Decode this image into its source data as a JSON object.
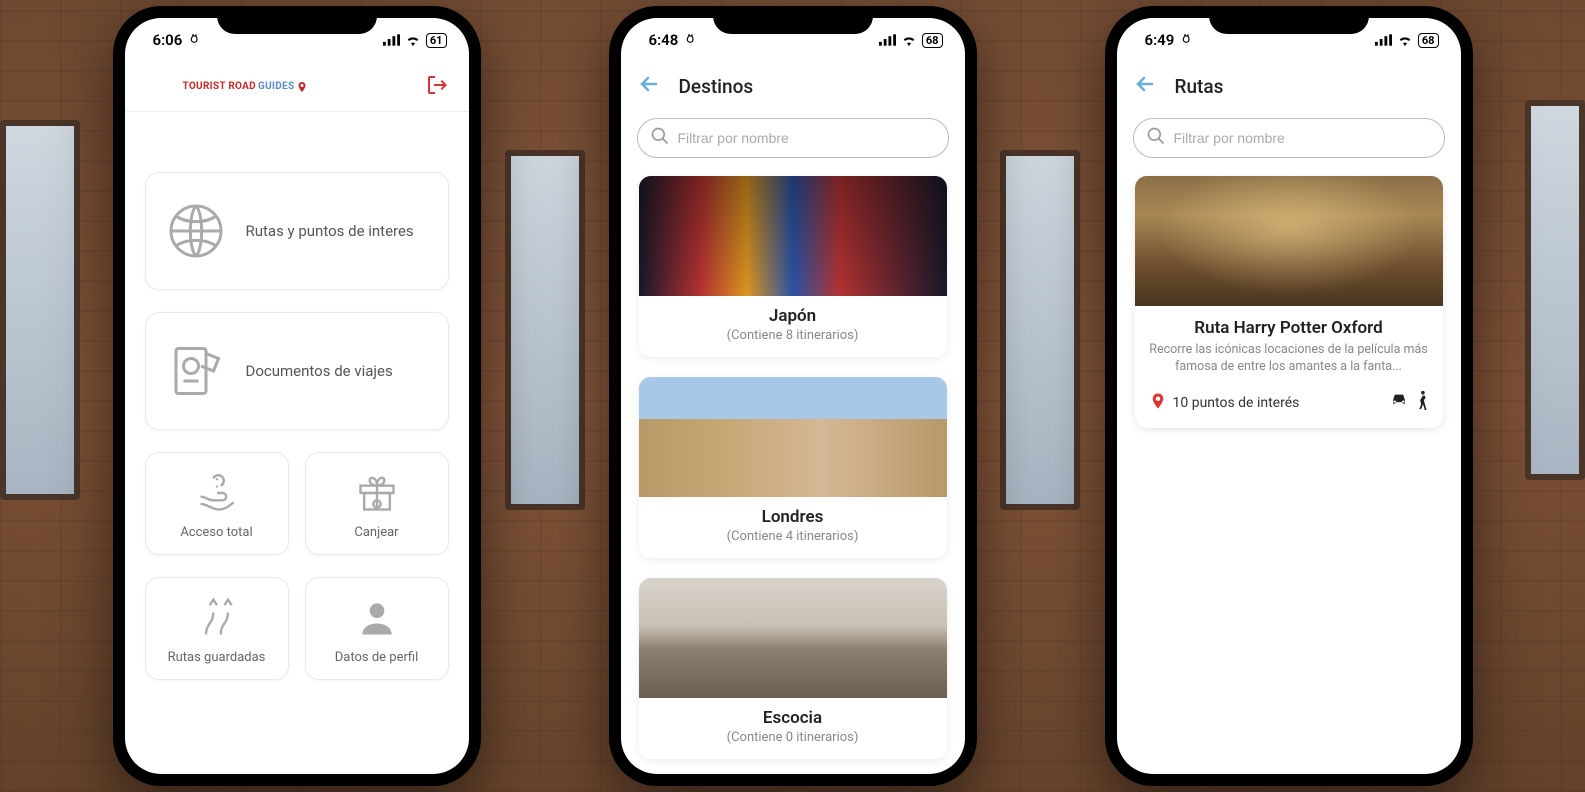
{
  "screen1": {
    "status": {
      "time": "6:06",
      "battery": "61"
    },
    "logo": {
      "part1": "TOURIST ROAD",
      "part2": "GUIDES"
    },
    "menu": {
      "routes": "Rutas y puntos de interes",
      "documents": "Documentos de viajes",
      "access": "Acceso total",
      "redeem": "Canjear",
      "saved": "Rutas guardadas",
      "profile": "Datos de perfil"
    }
  },
  "screen2": {
    "status": {
      "time": "6:48",
      "battery": "68"
    },
    "title": "Destinos",
    "search_placeholder": "Filtrar por nombre",
    "destinations": [
      {
        "title": "Japón",
        "subtitle": "(Contiene 8 itinerarios)"
      },
      {
        "title": "Londres",
        "subtitle": "(Contiene 4 itinerarios)"
      },
      {
        "title": "Escocia",
        "subtitle": "(Contiene 0 itinerarios)"
      }
    ]
  },
  "screen3": {
    "status": {
      "time": "6:49",
      "battery": "68"
    },
    "title": "Rutas",
    "search_placeholder": "Filtrar por nombre",
    "route": {
      "title": "Ruta Harry Potter Oxford",
      "description": "Recorre las icónicas locaciones de la película más famosa de entre los amantes a la fanta...",
      "poi": "10 puntos de interés"
    }
  }
}
